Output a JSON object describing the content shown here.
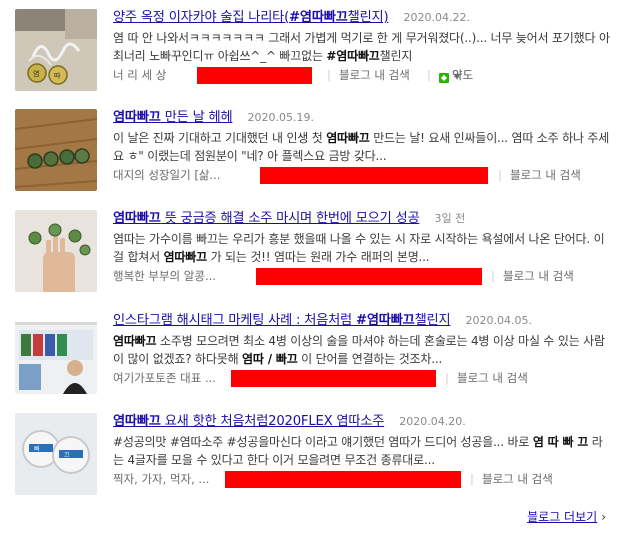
{
  "results": [
    {
      "title_pre": "양주 옥정 이자카야 술집 나리타(",
      "title_bold": "#염따빠끄",
      "title_post": "챌린지)",
      "date": "2020.04.22.",
      "snippet_pre": "염 따 안 나와서ㅋㅋㅋㅋㅋㅋㅋ 그래서 가볍게 먹기로 한 게 무거워졌다(..)... 너무 늦어서 포기했다 아 최너리 노빠꾸인디ㅠ 아쉽쓰^_^ 빠끄없는 ",
      "snippet_bold": "#염따빠끄",
      "snippet_post": "챌린지",
      "author": "너 리 세 상",
      "blog_search": "블로그 내 검색",
      "translate": "약도",
      "thumb_icon": "soju-caps-photo"
    },
    {
      "title_pre": "",
      "title_bold": "염따빠끄",
      "title_post": " 만든 날 헤헤",
      "date": "2020.05.19.",
      "snippet_pre": "이 날은 진짜 기대하고 기대했던 내 인생 첫 ",
      "snippet_bold": "염따빠끄",
      "snippet_post": " 만드는 날! 요새 인싸들이... 염따 소주 하나 주세요 ㅎ\" 이랬는데 점원분이 \"네? 아 플렉스요 금방 갖다...",
      "author": "대지의 성장일기 [삶...",
      "blog_search": "블로그 내 검색",
      "thumb_icon": "caps-on-wood-photo"
    },
    {
      "title_pre": "",
      "title_bold": "염따빠끄",
      "title_post": " 뜻 궁금증 해결 소주 마시며 한번에 모으기 성공",
      "date": "3일 전",
      "snippet_pre": "염따는 가수이름 빠끄는 우리가 흥분 했을때 나올 수 있는 시 자로 시작하는 욕설에서 나온 단어다. 이걸 합쳐서 ",
      "snippet_bold": "염따빠끄",
      "snippet_post": " 가 되는 것!! 염따는 원래 가수 래퍼의 본명...",
      "author": "행복한 부부의 알콩...",
      "blog_search": "블로그 내 검색",
      "thumb_icon": "hand-with-caps-photo"
    },
    {
      "title_pre": "인스타그램 해시태그 마케팅 사례 : 처음처럼 ",
      "title_bold": "#염따빠끄",
      "title_post": "챌린지",
      "date": "2020.04.05.",
      "snippet_pre": "",
      "snippet_bold": "염따빠끄",
      "snippet_post": " 소주병 모으려면 최소 4병 이상의 술을 마셔야 하는데 혼술로는 4병 이상 마실 수 있는 사람이 많이 없겠죠? 하다못해 ",
      "snippet_bold2": "염따 / 빠끄",
      "snippet_post2": " 이 단어를 연결하는 것조차...",
      "author": "여기가포토존 대표 ...",
      "blog_search": "블로그 내 검색",
      "thumb_icon": "store-screenshot-photo"
    },
    {
      "title_pre": "",
      "title_bold": "염따빠끄",
      "title_post": " 요새 핫한 처음처럼2020FLEX 염따소주",
      "date": "2020.04.20.",
      "snippet_pre": "#성공의맛 #염따소주 #성공을마신다 이라고 얘기했던 염따가 드디어 성공을... 바로 ",
      "snippet_bold": "염 따 빠 끄",
      "snippet_post": " 라는 4글자를 모을 수 있다고 한다 이거 모을려면 무조건 종류대로...",
      "author": "찍자, 가자, 먹자, ...",
      "blog_search": "블로그 내 검색",
      "thumb_icon": "two-caps-photo"
    }
  ],
  "more_link": "블로그 더보기",
  "more_arrow": "›",
  "colors": {
    "link": "#1a0dab",
    "redaction": "#ff0000"
  }
}
